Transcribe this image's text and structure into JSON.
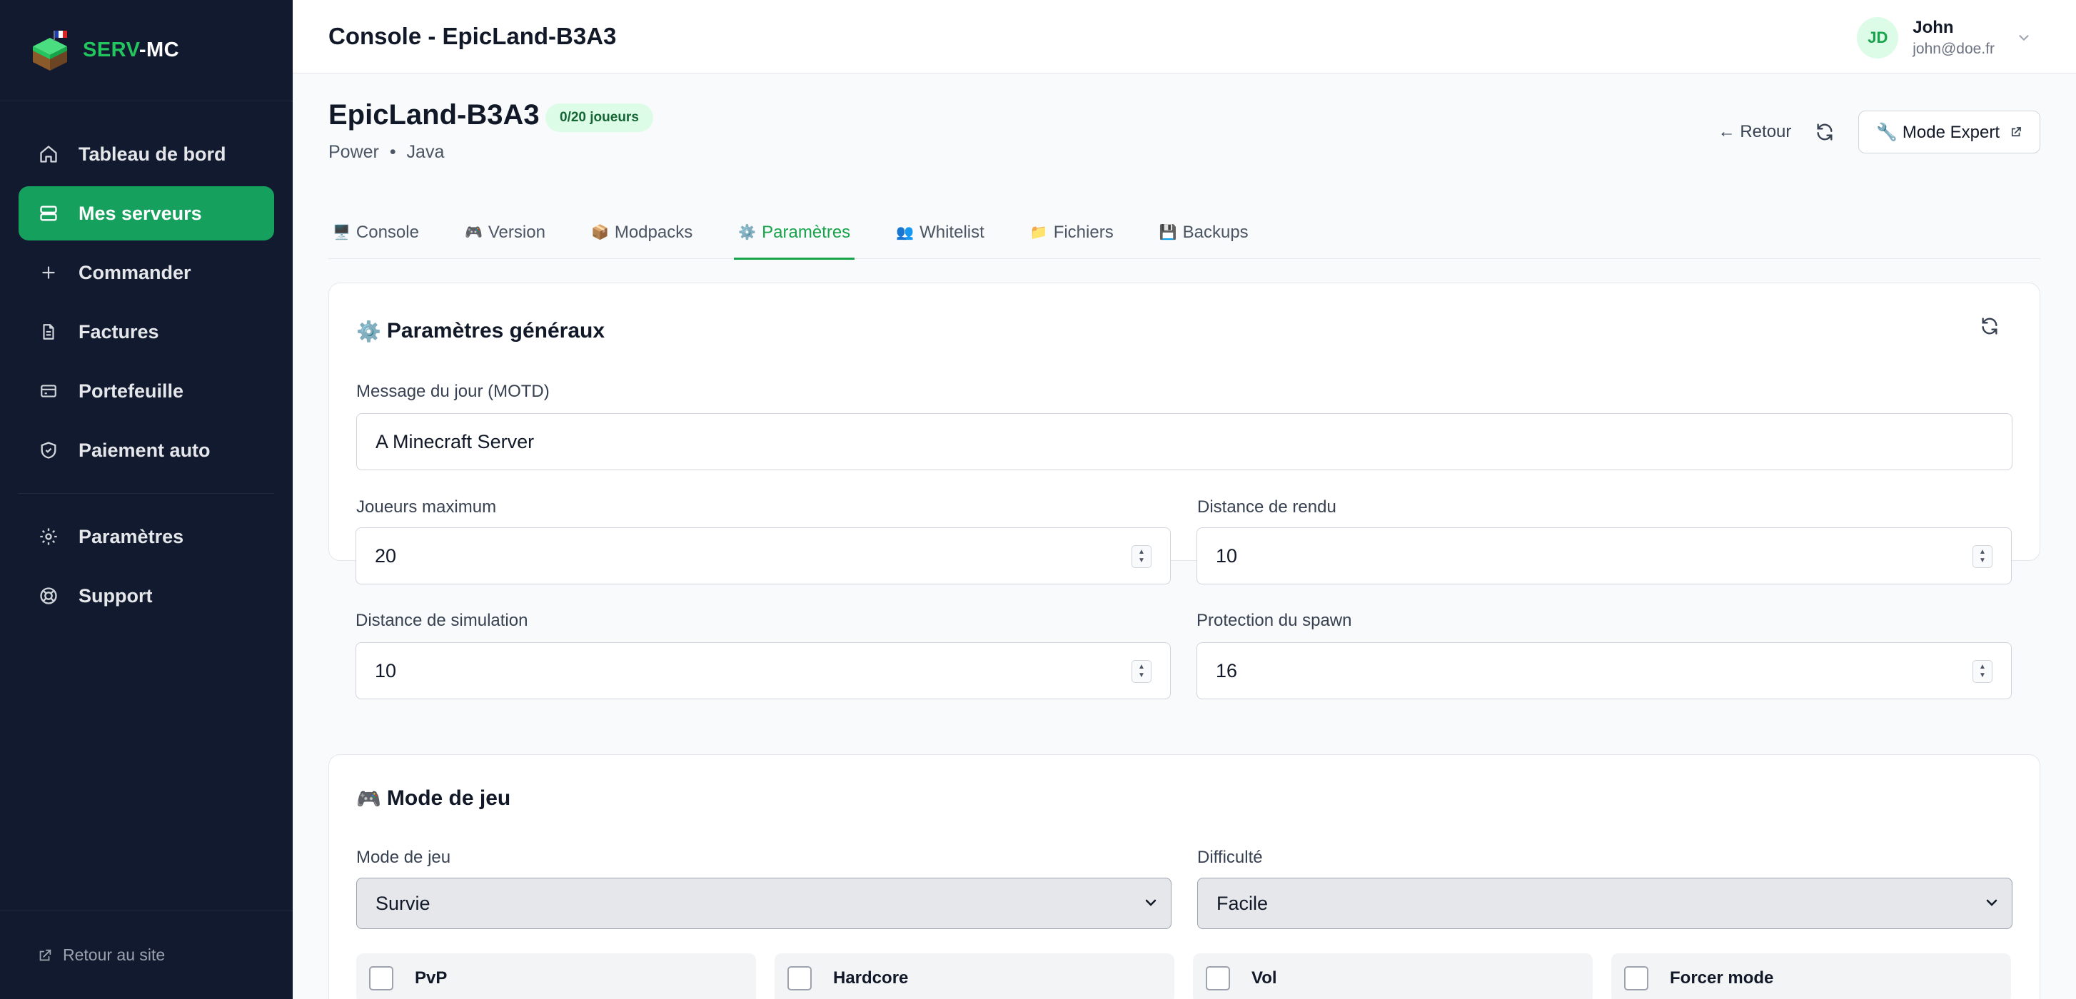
{
  "brand": {
    "name_part1": "SERV",
    "name_part2": "-MC"
  },
  "sidebar": {
    "items": [
      {
        "label": "Tableau de bord",
        "icon": "home-icon"
      },
      {
        "label": "Mes serveurs",
        "icon": "server-icon",
        "active": true
      },
      {
        "label": "Commander",
        "icon": "plus-icon"
      },
      {
        "label": "Factures",
        "icon": "file-icon"
      },
      {
        "label": "Portefeuille",
        "icon": "wallet-icon"
      },
      {
        "label": "Paiement auto",
        "icon": "shield-icon"
      }
    ],
    "secondary": [
      {
        "label": "Paramètres",
        "icon": "gear-icon"
      },
      {
        "label": "Support",
        "icon": "lifebuoy-icon"
      }
    ],
    "footer": "Retour au site"
  },
  "header": {
    "title": "Console - EpicLand-B3A3",
    "user": {
      "initials": "JD",
      "name": "John",
      "email": "john@doe.fr"
    }
  },
  "server": {
    "name": "EpicLand-B3A3",
    "badge": "0/20 joueurs",
    "plan": "Power",
    "edition": "Java",
    "back_label": "← Retour",
    "expert_label": "🔧 Mode Expert"
  },
  "tabs": [
    {
      "emoji": "🖥️",
      "label": "Console"
    },
    {
      "emoji": "🎮",
      "label": "Version"
    },
    {
      "emoji": "📦",
      "label": "Modpacks"
    },
    {
      "emoji": "⚙️",
      "label": "Paramètres",
      "active": true
    },
    {
      "emoji": "👥",
      "label": "Whitelist"
    },
    {
      "emoji": "📁",
      "label": "Fichiers"
    },
    {
      "emoji": "💾",
      "label": "Backups"
    }
  ],
  "general": {
    "emoji": "⚙️",
    "title": "Paramètres généraux",
    "motd_label": "Message du jour (MOTD)",
    "motd_value": "A Minecraft Server",
    "max_players_label": "Joueurs maximum",
    "max_players_value": "20",
    "render_distance_label": "Distance de rendu",
    "render_distance_value": "10",
    "sim_distance_label": "Distance de simulation",
    "sim_distance_value": "10",
    "spawn_protection_label": "Protection du spawn",
    "spawn_protection_value": "16"
  },
  "gamemode": {
    "emoji": "🎮",
    "title": "Mode de jeu",
    "mode_label": "Mode de jeu",
    "mode_value": "Survie",
    "difficulty_label": "Difficulté",
    "difficulty_value": "Facile",
    "checks": [
      "PvP",
      "Hardcore",
      "Vol",
      "Forcer mode"
    ]
  },
  "colors": {
    "accent": "#16a05e",
    "sidebar_bg": "#111a2e"
  }
}
